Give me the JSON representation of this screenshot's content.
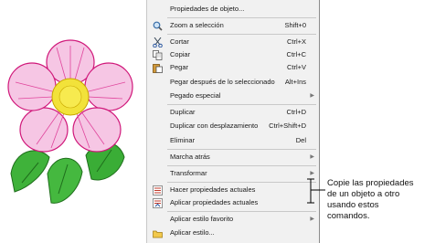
{
  "menu": {
    "items": [
      {
        "label": "Propiedades de objeto...",
        "shortcut": "",
        "submenu": false,
        "icon": ""
      },
      {
        "label": "Zoom a selección",
        "shortcut": "Shift+0",
        "submenu": false,
        "icon": "zoom-icon"
      },
      {
        "label": "Cortar",
        "shortcut": "Ctrl+X",
        "submenu": false,
        "icon": "scissors-icon"
      },
      {
        "label": "Copiar",
        "shortcut": "Ctrl+C",
        "submenu": false,
        "icon": "copy-icon"
      },
      {
        "label": "Pegar",
        "shortcut": "Ctrl+V",
        "submenu": false,
        "icon": "paste-icon"
      },
      {
        "label": "Pegar después de lo seleccionado",
        "shortcut": "Alt+Ins",
        "submenu": false,
        "icon": ""
      },
      {
        "label": "Pegado especial",
        "shortcut": "",
        "submenu": true,
        "icon": ""
      },
      {
        "label": "Duplicar",
        "shortcut": "Ctrl+D",
        "submenu": false,
        "icon": ""
      },
      {
        "label": "Duplicar con desplazamiento",
        "shortcut": "Ctrl+Shift+D",
        "submenu": false,
        "icon": ""
      },
      {
        "label": "Eliminar",
        "shortcut": "Del",
        "submenu": false,
        "icon": ""
      },
      {
        "label": "Marcha atrás",
        "shortcut": "",
        "submenu": true,
        "icon": ""
      },
      {
        "label": "Transformar",
        "shortcut": "",
        "submenu": true,
        "icon": ""
      },
      {
        "label": "Hacer propiedades actuales",
        "shortcut": "",
        "submenu": false,
        "icon": "make-current-icon"
      },
      {
        "label": "Aplicar propiedades actuales",
        "shortcut": "",
        "submenu": false,
        "icon": "apply-current-icon"
      },
      {
        "label": "Aplicar estilo favorito",
        "shortcut": "",
        "submenu": true,
        "icon": ""
      },
      {
        "label": "Aplicar estilo...",
        "shortcut": "",
        "submenu": false,
        "icon": "apply-style-icon"
      }
    ],
    "submenu_arrow": "▶"
  },
  "callout": {
    "lines": [
      "Copie las propiedades",
      "de un objeto a otro",
      "usando estos",
      "comandos."
    ]
  },
  "colors": {
    "menu_bg": "#f1f1f1",
    "petal_pink": "#f0a8d8",
    "petal_stroke": "#d0187a",
    "flower_center": "#f2e23a",
    "leaf_green": "#3fb23a"
  }
}
